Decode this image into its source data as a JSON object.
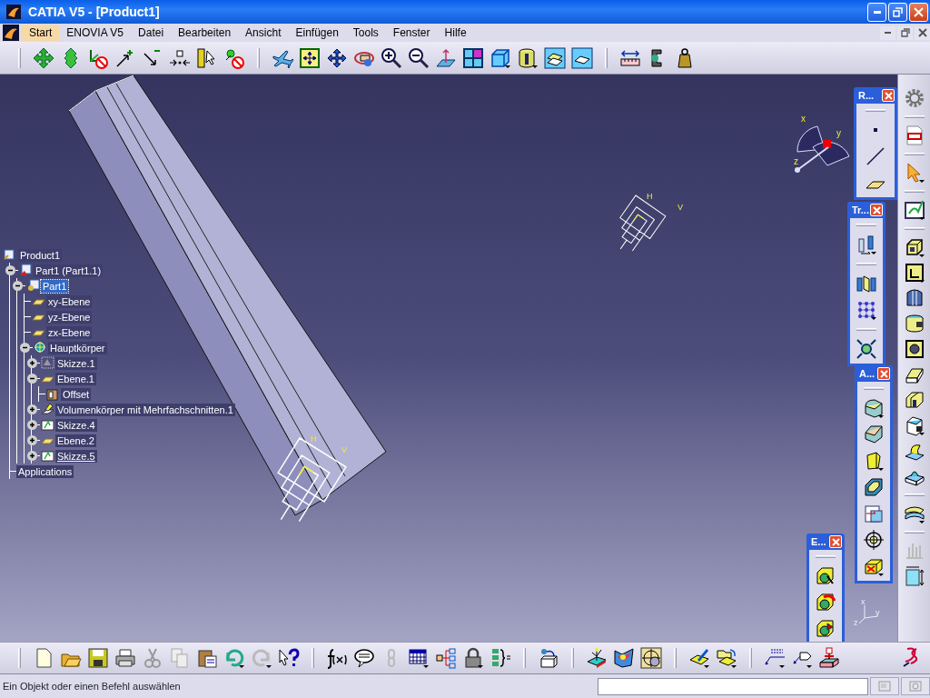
{
  "window": {
    "title": "CATIA V5 - [Product1]"
  },
  "menu": [
    {
      "label": "Start",
      "selected": true
    },
    {
      "label": "ENOVIA V5",
      "selected": false
    },
    {
      "label": "Datei",
      "selected": false
    },
    {
      "label": "Bearbeiten",
      "selected": false
    },
    {
      "label": "Ansicht",
      "selected": false
    },
    {
      "label": "Einfügen",
      "selected": false
    },
    {
      "label": "Tools",
      "selected": false
    },
    {
      "label": "Fenster",
      "selected": false
    },
    {
      "label": "Hilfe",
      "selected": false
    }
  ],
  "tree": [
    {
      "label": "Product1",
      "kind": "product",
      "selected": false,
      "in_work": false,
      "children": [
        {
          "label": "Part1 (Part1.1)",
          "kind": "part_instance",
          "selected": false,
          "in_work": false,
          "expanded": true,
          "children": [
            {
              "label": "Part1",
              "kind": "part",
              "selected": true,
              "in_work": false,
              "expanded": true,
              "children": [
                {
                  "label": "xy-Ebene",
                  "kind": "plane",
                  "selected": false,
                  "in_work": false
                },
                {
                  "label": "yz-Ebene",
                  "kind": "plane",
                  "selected": false,
                  "in_work": false
                },
                {
                  "label": "zx-Ebene",
                  "kind": "plane",
                  "selected": false,
                  "in_work": false
                },
                {
                  "label": "Hauptkörper",
                  "kind": "body",
                  "selected": false,
                  "in_work": false,
                  "expanded": true,
                  "children": [
                    {
                      "label": "Skizze.1",
                      "kind": "sketch_hidden",
                      "selected": false,
                      "in_work": false,
                      "expanded": false
                    },
                    {
                      "label": "Ebene.1",
                      "kind": "plane",
                      "selected": false,
                      "in_work": false,
                      "expanded": true,
                      "children": [
                        {
                          "label": "Offset",
                          "kind": "parameter",
                          "selected": false,
                          "in_work": false
                        }
                      ]
                    },
                    {
                      "label": "Volumenkörper mit Mehrfachschnitten.1",
                      "kind": "solid",
                      "selected": false,
                      "in_work": false,
                      "expanded": false
                    },
                    {
                      "label": "Skizze.4",
                      "kind": "sketch",
                      "selected": false,
                      "in_work": false,
                      "expanded": false
                    },
                    {
                      "label": "Ebene.2",
                      "kind": "plane",
                      "selected": false,
                      "in_work": false,
                      "expanded": false
                    },
                    {
                      "label": "Skizze.5",
                      "kind": "sketch",
                      "selected": false,
                      "in_work": true,
                      "expanded": false
                    }
                  ]
                }
              ]
            }
          ]
        },
        {
          "label": "Applications",
          "kind": "none",
          "selected": false,
          "in_work": false
        }
      ]
    }
  ],
  "compass": {
    "labels": [
      "x",
      "y",
      "z"
    ]
  },
  "sketch_axes": [
    {
      "h": "H",
      "v": "V"
    },
    {
      "h": "H",
      "v": "V"
    }
  ],
  "axis_triad": {
    "labels": [
      "x",
      "y",
      "z"
    ]
  },
  "floating_toolbars": [
    {
      "title": "R..."
    },
    {
      "title": "Tr..."
    },
    {
      "title": "A..."
    },
    {
      "title": "E..."
    }
  ],
  "status_bar": {
    "message": "Ein Objekt oder einen Befehl auswählen"
  }
}
